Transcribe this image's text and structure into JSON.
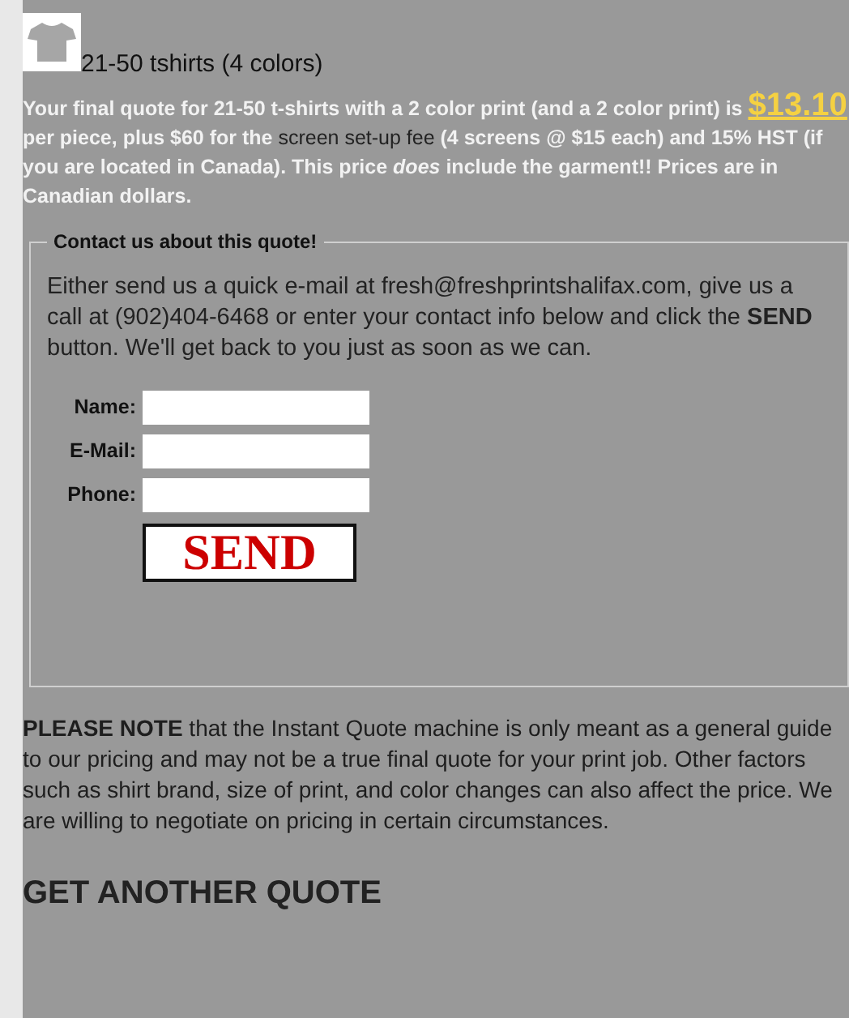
{
  "product": {
    "title": "21-50 tshirts (4 colors)"
  },
  "quote": {
    "segments": [
      {
        "kind": "text",
        "text": "Your final quote for 21-50 t-shirts with a 2 color print  (and a 2 color print) is "
      },
      {
        "kind": "price",
        "text": "$13.10"
      },
      {
        "kind": "text",
        "text": "  per piece, plus $60 for the "
      },
      {
        "kind": "link",
        "text": "screen set-up fee"
      },
      {
        "kind": "text",
        "text": " (4 screens @ $15 each) and 15% HST (if you are located in Canada). This price *does* include the garment!! Prices are in Canadian dollars."
      }
    ]
  },
  "contact": {
    "legend": "Contact us about this quote!",
    "intro": "Either send us a quick e-mail at fresh@freshprintshalifax.com, give us a call at (902)404-6468 or enter your contact info below and click the **SEND** button. We'll get back to you just as soon as we can.",
    "fields": [
      {
        "label": "Name:"
      },
      {
        "label": "E-Mail:"
      },
      {
        "label": "Phone:"
      }
    ],
    "send_button": "SEND"
  },
  "note": "**PLEASE NOTE** that the Instant Quote machine is only meant as a general guide to our pricing and may not be a true final quote for your print job. Other factors such as shirt brand, size of print, and color changes can also affect the price. We are willing to negotiate on pricing in certain circumstances.",
  "another_quote": "GET ANOTHER QUOTE"
}
